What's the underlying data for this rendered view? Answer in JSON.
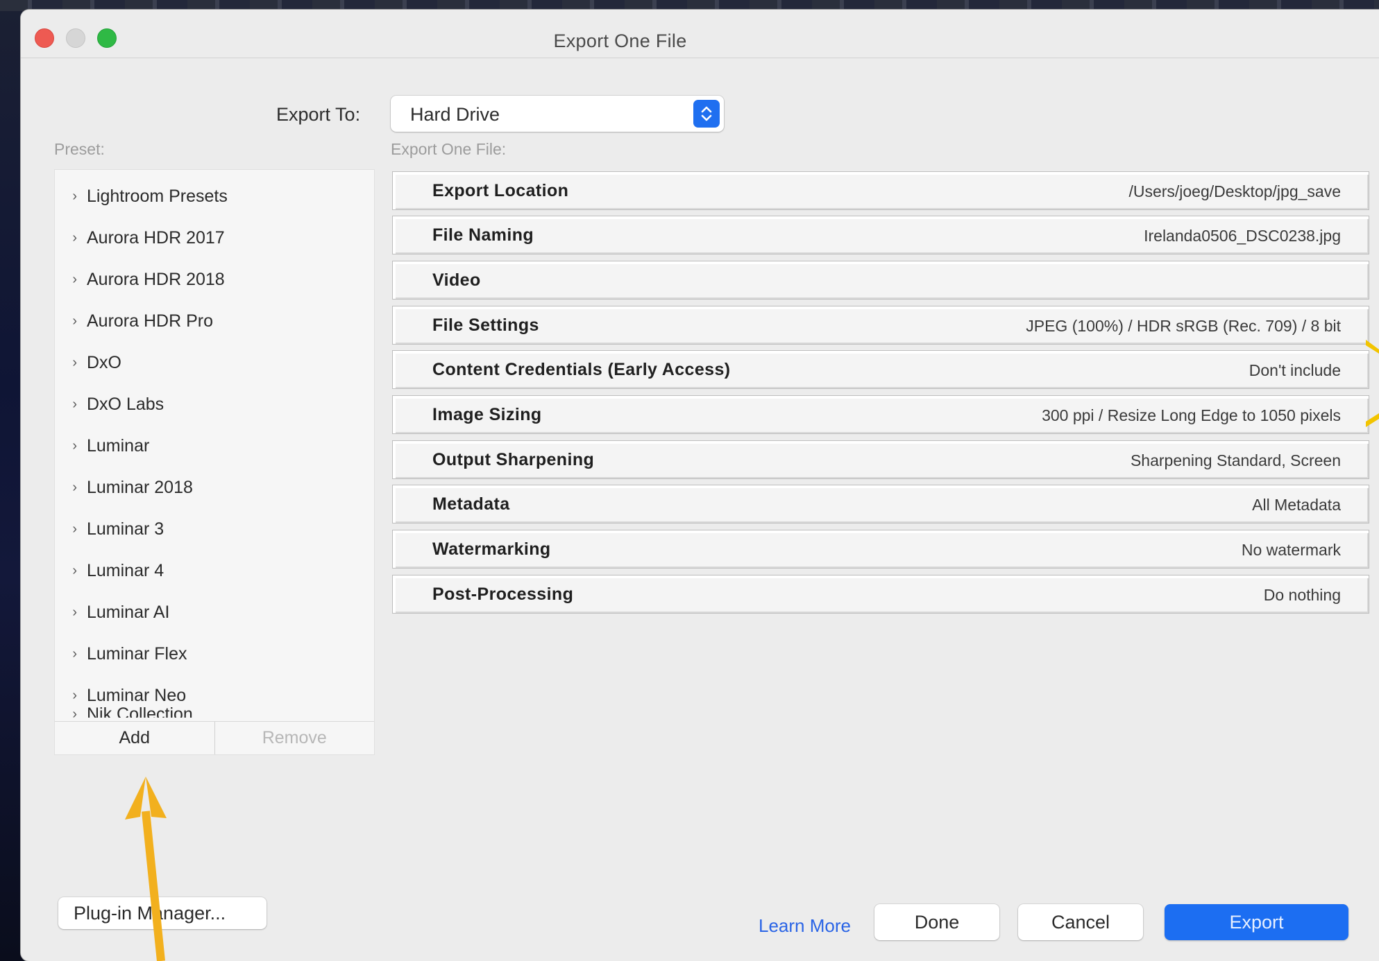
{
  "window": {
    "title": "Export One File"
  },
  "export_to": {
    "label": "Export To:",
    "value": "Hard Drive"
  },
  "preset": {
    "heading": "Preset:",
    "items": [
      "Lightroom Presets",
      "Aurora HDR 2017",
      "Aurora HDR 2018",
      "Aurora HDR Pro",
      "DxO",
      "DxO Labs",
      "Luminar",
      "Luminar 2018",
      "Luminar 3",
      "Luminar 4",
      "Luminar AI",
      "Luminar Flex",
      "Luminar Neo",
      "Nik Collection"
    ],
    "add_label": "Add",
    "remove_label": "Remove"
  },
  "export_sections": {
    "heading": "Export One File:",
    "rows": [
      {
        "name": "Export Location",
        "value": "/Users/joeg/Desktop/jpg_save"
      },
      {
        "name": "File Naming",
        "value": "Irelanda0506_DSC0238.jpg"
      },
      {
        "name": "Video",
        "value": ""
      },
      {
        "name": "File Settings",
        "value": "JPEG (100%) / HDR sRGB (Rec. 709) / 8 bit"
      },
      {
        "name": "Content Credentials (Early Access)",
        "value": "Don't include"
      },
      {
        "name": "Image Sizing",
        "value": "300 ppi / Resize Long Edge to 1050 pixels"
      },
      {
        "name": "Output Sharpening",
        "value": "Sharpening Standard, Screen"
      },
      {
        "name": "Metadata",
        "value": "All Metadata"
      },
      {
        "name": "Watermarking",
        "value": "No watermark"
      },
      {
        "name": "Post-Processing",
        "value": "Do nothing"
      }
    ]
  },
  "footer": {
    "plugin_manager": "Plug-in Manager...",
    "learn_more": "Learn More",
    "done": "Done",
    "cancel": "Cancel",
    "export": "Export"
  },
  "colors": {
    "accent": "#1c6ef2",
    "annotation_arrow": "#f2b01e",
    "close": "#ee5a52",
    "maximize": "#2fb945"
  }
}
